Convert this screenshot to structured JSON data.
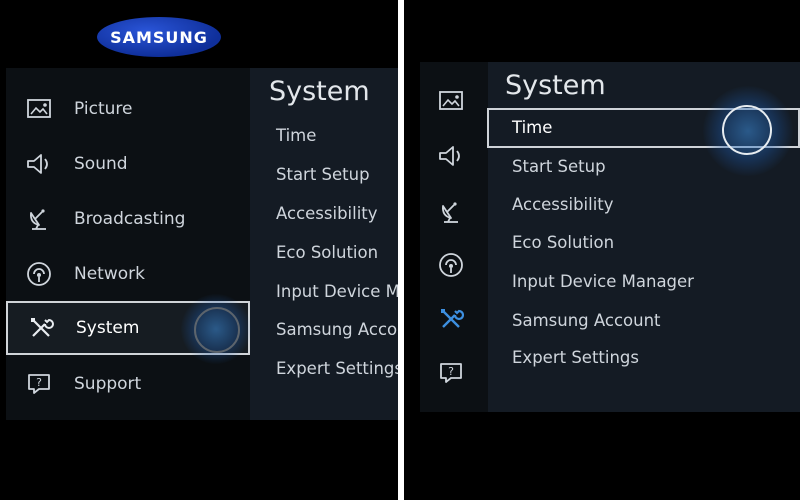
{
  "left_screen": {
    "brand_logo_text": "SAMSUNG",
    "menu": [
      {
        "label": "Picture",
        "icon": "picture-icon"
      },
      {
        "label": "Sound",
        "icon": "speaker-icon"
      },
      {
        "label": "Broadcasting",
        "icon": "satellite-dish-icon"
      },
      {
        "label": "Network",
        "icon": "network-icon"
      },
      {
        "label": "System",
        "icon": "tools-icon",
        "selected": true
      },
      {
        "label": "Support",
        "icon": "help-chat-icon"
      }
    ],
    "submenu": {
      "title": "System",
      "items": [
        "Time",
        "Start Setup",
        "Accessibility",
        "Eco Solution",
        "Input Device Ma",
        "Samsung Accou",
        "Expert Settings"
      ]
    }
  },
  "right_screen": {
    "icons": [
      "picture-icon",
      "speaker-icon",
      "satellite-dish-icon",
      "network-icon",
      "tools-icon",
      "help-chat-icon"
    ],
    "submenu": {
      "title": "System",
      "items": [
        "Time",
        "Start Setup",
        "Accessibility",
        "Eco Solution",
        "Input Device Manager",
        "Samsung Account",
        "Expert Settings"
      ],
      "selected_item": "Time"
    }
  },
  "colors": {
    "accent_selected_icon": "#3d8fe0",
    "logo_blue": "#1a3fb8",
    "submenu_bg": "#141b24"
  }
}
